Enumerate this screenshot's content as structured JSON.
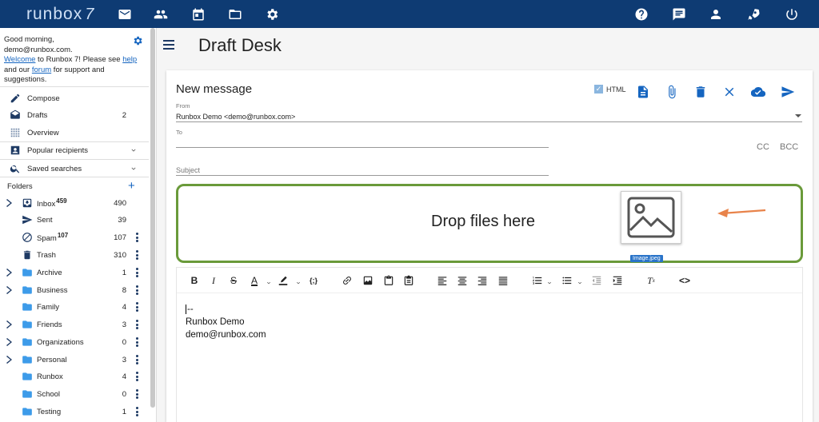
{
  "app": {
    "logo_text": "runbox",
    "logo_suffix": "7"
  },
  "topbar": {
    "left_icons": [
      "mail-icon",
      "contacts-icon",
      "calendar-icon",
      "files-icon",
      "settings-icon"
    ],
    "right_icons": [
      "help-icon",
      "feedback-icon",
      "account-icon",
      "rocket-icon",
      "power-icon"
    ]
  },
  "sidebar": {
    "greeting_line1": "Good morning,",
    "greeting_line2": "demo@runbox.com.",
    "welcome_link": "Welcome",
    "welcome_rest": " to Runbox 7! Please see ",
    "help_link": "help",
    "and_our": " and our ",
    "forum_link": "forum",
    "support_rest": " for support and suggestions.",
    "nav": [
      {
        "label": "Compose",
        "icon": "pencil-icon"
      },
      {
        "label": "Drafts",
        "count": "2",
        "icon": "drafts-icon"
      },
      {
        "label": "Overview",
        "icon": "grid-icon"
      },
      {
        "label": "Popular recipients",
        "icon": "person-icon"
      },
      {
        "label": "Saved searches",
        "icon": "search-icon"
      }
    ],
    "folders_title": "Folders",
    "folders_add": "+",
    "folders": [
      {
        "label": "Inbox",
        "badge": "459",
        "count": "490"
      },
      {
        "label": "Sent",
        "count": "39"
      },
      {
        "label": "Spam",
        "badge": "107",
        "count": "107"
      },
      {
        "label": "Trash",
        "count": "310"
      },
      {
        "label": "Archive",
        "count": "1"
      },
      {
        "label": "Business",
        "count": "8"
      },
      {
        "label": "Family",
        "count": "4"
      },
      {
        "label": "Friends",
        "count": "3"
      },
      {
        "label": "Organizations",
        "count": "0"
      },
      {
        "label": "Personal",
        "count": "3"
      },
      {
        "label": "Runbox",
        "count": "4"
      },
      {
        "label": "School",
        "count": "0"
      },
      {
        "label": "Testing",
        "count": "1"
      }
    ]
  },
  "main": {
    "page_title": "Draft Desk",
    "compose": {
      "title": "New message",
      "html_label": "HTML",
      "from_label": "From",
      "from_value": "Runbox Demo <demo@runbox.com>",
      "to_label": "To",
      "subject_label": "Subject",
      "cc_label": "CC",
      "bcc_label": "BCC",
      "drop_text": "Drop files here",
      "drag_file_label": "Image.jpeg",
      "signature": [
        "--",
        "Runbox Demo",
        "demo@runbox.com"
      ]
    }
  },
  "colors": {
    "topbar": "#0e3b73",
    "accent": "#1565c0",
    "dropzone_border": "#6a9a3a",
    "arrow": "#e8834a"
  }
}
